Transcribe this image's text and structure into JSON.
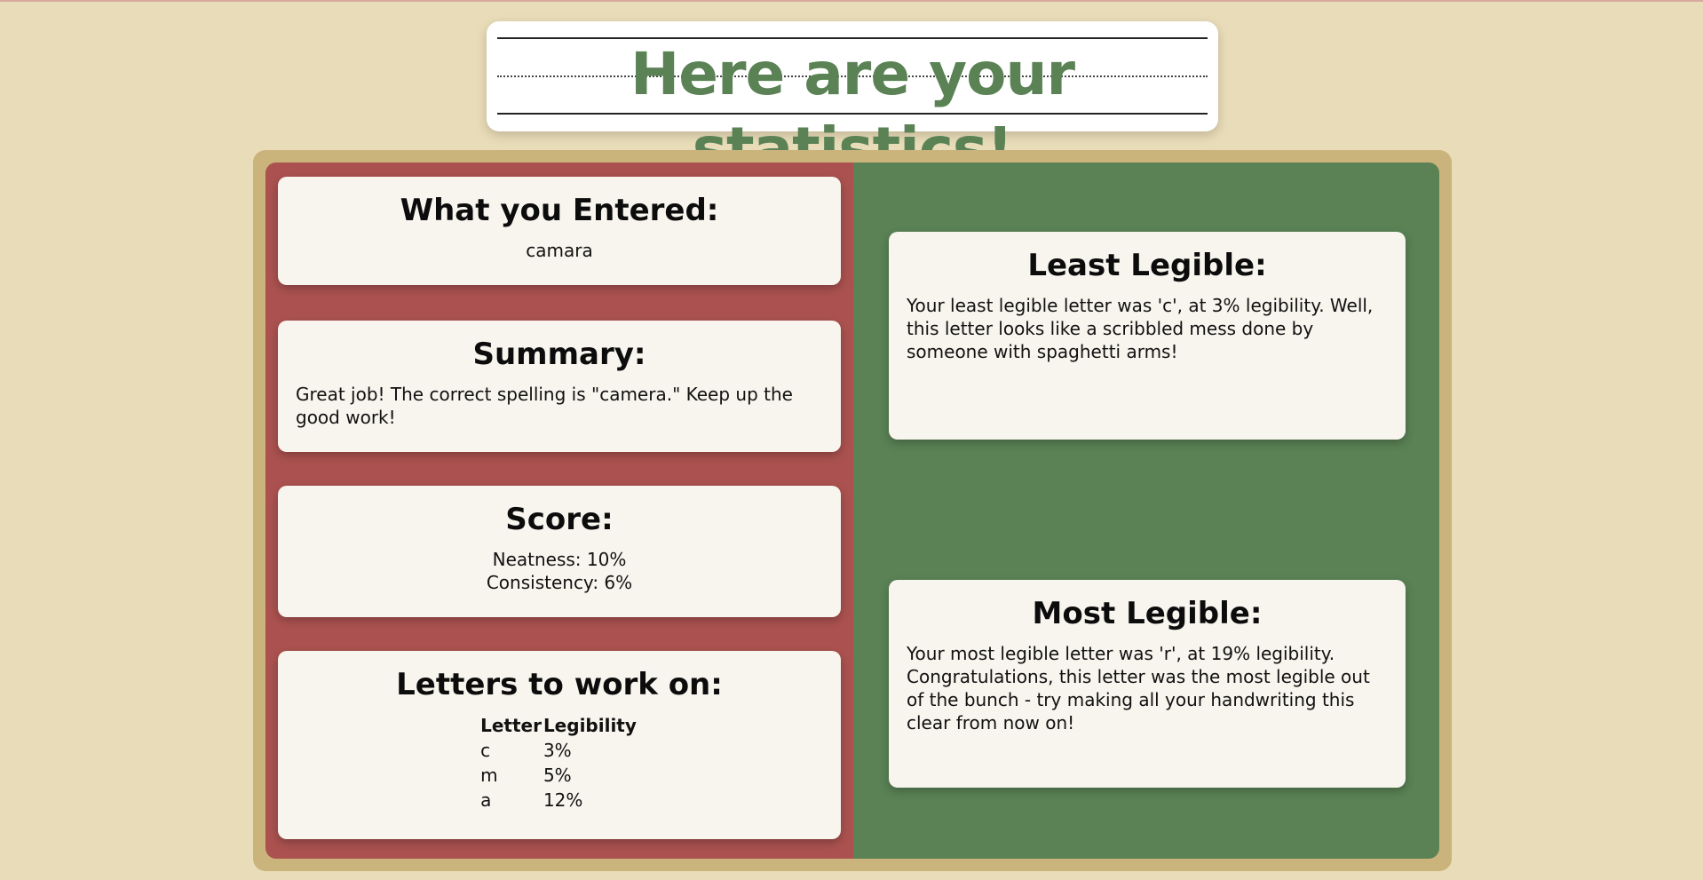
{
  "header": {
    "title": "Here are your statistics!"
  },
  "entered": {
    "heading": "What you Entered:",
    "value": "camara"
  },
  "summary": {
    "heading": "Summary:",
    "text": "Great job! The correct spelling is \"camera.\" Keep up the good work!"
  },
  "score": {
    "heading": "Score:",
    "neatness": "Neatness: 10%",
    "consistency": "Consistency: 6%"
  },
  "letters": {
    "heading": "Letters to work on:",
    "columns": [
      "Letter",
      "Legibility"
    ],
    "rows": [
      {
        "letter": "c",
        "legibility": "3%"
      },
      {
        "letter": "m",
        "legibility": "5%"
      },
      {
        "letter": "a",
        "legibility": "12%"
      }
    ]
  },
  "least_legible": {
    "heading": "Least Legible:",
    "text": "Your least legible letter was 'c', at 3% legibility. Well, this letter looks like a scribbled mess done by someone with spaghetti arms!"
  },
  "most_legible": {
    "heading": "Most Legible:",
    "text": "Your most legible letter was 'r', at 19% legibility. Congratulations, this letter was the most legible out of the bunch - try making all your handwriting this clear from now on!"
  },
  "colors": {
    "background": "#e9dcb8",
    "title_green": "#5a8255",
    "panel_red": "#ab5250",
    "panel_green": "#5a8255",
    "board_tan": "#cbb37c",
    "card": "#f8f5ee"
  }
}
